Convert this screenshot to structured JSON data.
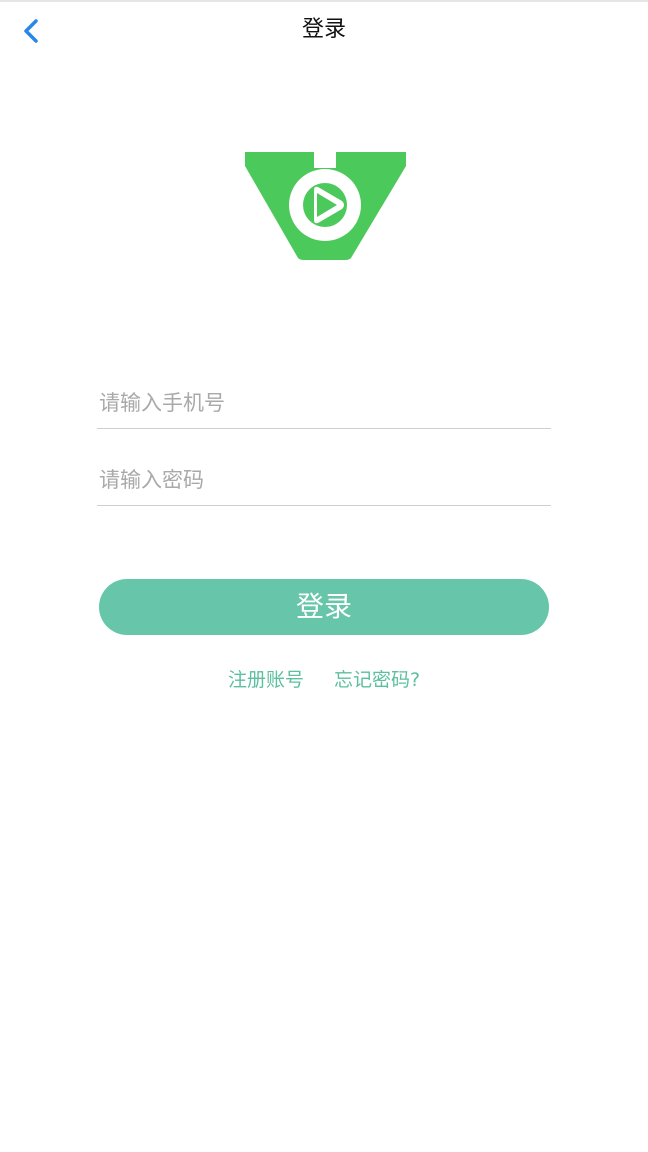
{
  "header": {
    "title": "登录",
    "back_icon": "chevron-left-icon"
  },
  "form": {
    "phone_placeholder": "请输入手机号",
    "phone_value": "",
    "password_placeholder": "请输入密码",
    "password_value": "",
    "login_label": "登录"
  },
  "links": {
    "register": "注册账号",
    "forgot": "忘记密码?"
  },
  "colors": {
    "accent_green": "#4cc95b",
    "button": "#67c6aa",
    "link": "#5cbf9f",
    "back_icon": "#2a86e8"
  }
}
